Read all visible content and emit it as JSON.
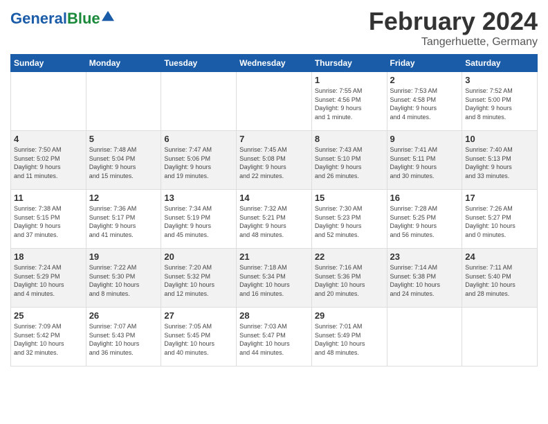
{
  "logo": {
    "text_general": "General",
    "text_blue": "Blue"
  },
  "title": "February 2024",
  "location": "Tangerhuette, Germany",
  "days_of_week": [
    "Sunday",
    "Monday",
    "Tuesday",
    "Wednesday",
    "Thursday",
    "Friday",
    "Saturday"
  ],
  "weeks": [
    [
      {
        "day": "",
        "info": ""
      },
      {
        "day": "",
        "info": ""
      },
      {
        "day": "",
        "info": ""
      },
      {
        "day": "",
        "info": ""
      },
      {
        "day": "1",
        "info": "Sunrise: 7:55 AM\nSunset: 4:56 PM\nDaylight: 9 hours\nand 1 minute."
      },
      {
        "day": "2",
        "info": "Sunrise: 7:53 AM\nSunset: 4:58 PM\nDaylight: 9 hours\nand 4 minutes."
      },
      {
        "day": "3",
        "info": "Sunrise: 7:52 AM\nSunset: 5:00 PM\nDaylight: 9 hours\nand 8 minutes."
      }
    ],
    [
      {
        "day": "4",
        "info": "Sunrise: 7:50 AM\nSunset: 5:02 PM\nDaylight: 9 hours\nand 11 minutes."
      },
      {
        "day": "5",
        "info": "Sunrise: 7:48 AM\nSunset: 5:04 PM\nDaylight: 9 hours\nand 15 minutes."
      },
      {
        "day": "6",
        "info": "Sunrise: 7:47 AM\nSunset: 5:06 PM\nDaylight: 9 hours\nand 19 minutes."
      },
      {
        "day": "7",
        "info": "Sunrise: 7:45 AM\nSunset: 5:08 PM\nDaylight: 9 hours\nand 22 minutes."
      },
      {
        "day": "8",
        "info": "Sunrise: 7:43 AM\nSunset: 5:10 PM\nDaylight: 9 hours\nand 26 minutes."
      },
      {
        "day": "9",
        "info": "Sunrise: 7:41 AM\nSunset: 5:11 PM\nDaylight: 9 hours\nand 30 minutes."
      },
      {
        "day": "10",
        "info": "Sunrise: 7:40 AM\nSunset: 5:13 PM\nDaylight: 9 hours\nand 33 minutes."
      }
    ],
    [
      {
        "day": "11",
        "info": "Sunrise: 7:38 AM\nSunset: 5:15 PM\nDaylight: 9 hours\nand 37 minutes."
      },
      {
        "day": "12",
        "info": "Sunrise: 7:36 AM\nSunset: 5:17 PM\nDaylight: 9 hours\nand 41 minutes."
      },
      {
        "day": "13",
        "info": "Sunrise: 7:34 AM\nSunset: 5:19 PM\nDaylight: 9 hours\nand 45 minutes."
      },
      {
        "day": "14",
        "info": "Sunrise: 7:32 AM\nSunset: 5:21 PM\nDaylight: 9 hours\nand 48 minutes."
      },
      {
        "day": "15",
        "info": "Sunrise: 7:30 AM\nSunset: 5:23 PM\nDaylight: 9 hours\nand 52 minutes."
      },
      {
        "day": "16",
        "info": "Sunrise: 7:28 AM\nSunset: 5:25 PM\nDaylight: 9 hours\nand 56 minutes."
      },
      {
        "day": "17",
        "info": "Sunrise: 7:26 AM\nSunset: 5:27 PM\nDaylight: 10 hours\nand 0 minutes."
      }
    ],
    [
      {
        "day": "18",
        "info": "Sunrise: 7:24 AM\nSunset: 5:29 PM\nDaylight: 10 hours\nand 4 minutes."
      },
      {
        "day": "19",
        "info": "Sunrise: 7:22 AM\nSunset: 5:30 PM\nDaylight: 10 hours\nand 8 minutes."
      },
      {
        "day": "20",
        "info": "Sunrise: 7:20 AM\nSunset: 5:32 PM\nDaylight: 10 hours\nand 12 minutes."
      },
      {
        "day": "21",
        "info": "Sunrise: 7:18 AM\nSunset: 5:34 PM\nDaylight: 10 hours\nand 16 minutes."
      },
      {
        "day": "22",
        "info": "Sunrise: 7:16 AM\nSunset: 5:36 PM\nDaylight: 10 hours\nand 20 minutes."
      },
      {
        "day": "23",
        "info": "Sunrise: 7:14 AM\nSunset: 5:38 PM\nDaylight: 10 hours\nand 24 minutes."
      },
      {
        "day": "24",
        "info": "Sunrise: 7:11 AM\nSunset: 5:40 PM\nDaylight: 10 hours\nand 28 minutes."
      }
    ],
    [
      {
        "day": "25",
        "info": "Sunrise: 7:09 AM\nSunset: 5:42 PM\nDaylight: 10 hours\nand 32 minutes."
      },
      {
        "day": "26",
        "info": "Sunrise: 7:07 AM\nSunset: 5:43 PM\nDaylight: 10 hours\nand 36 minutes."
      },
      {
        "day": "27",
        "info": "Sunrise: 7:05 AM\nSunset: 5:45 PM\nDaylight: 10 hours\nand 40 minutes."
      },
      {
        "day": "28",
        "info": "Sunrise: 7:03 AM\nSunset: 5:47 PM\nDaylight: 10 hours\nand 44 minutes."
      },
      {
        "day": "29",
        "info": "Sunrise: 7:01 AM\nSunset: 5:49 PM\nDaylight: 10 hours\nand 48 minutes."
      },
      {
        "day": "",
        "info": ""
      },
      {
        "day": "",
        "info": ""
      }
    ]
  ]
}
